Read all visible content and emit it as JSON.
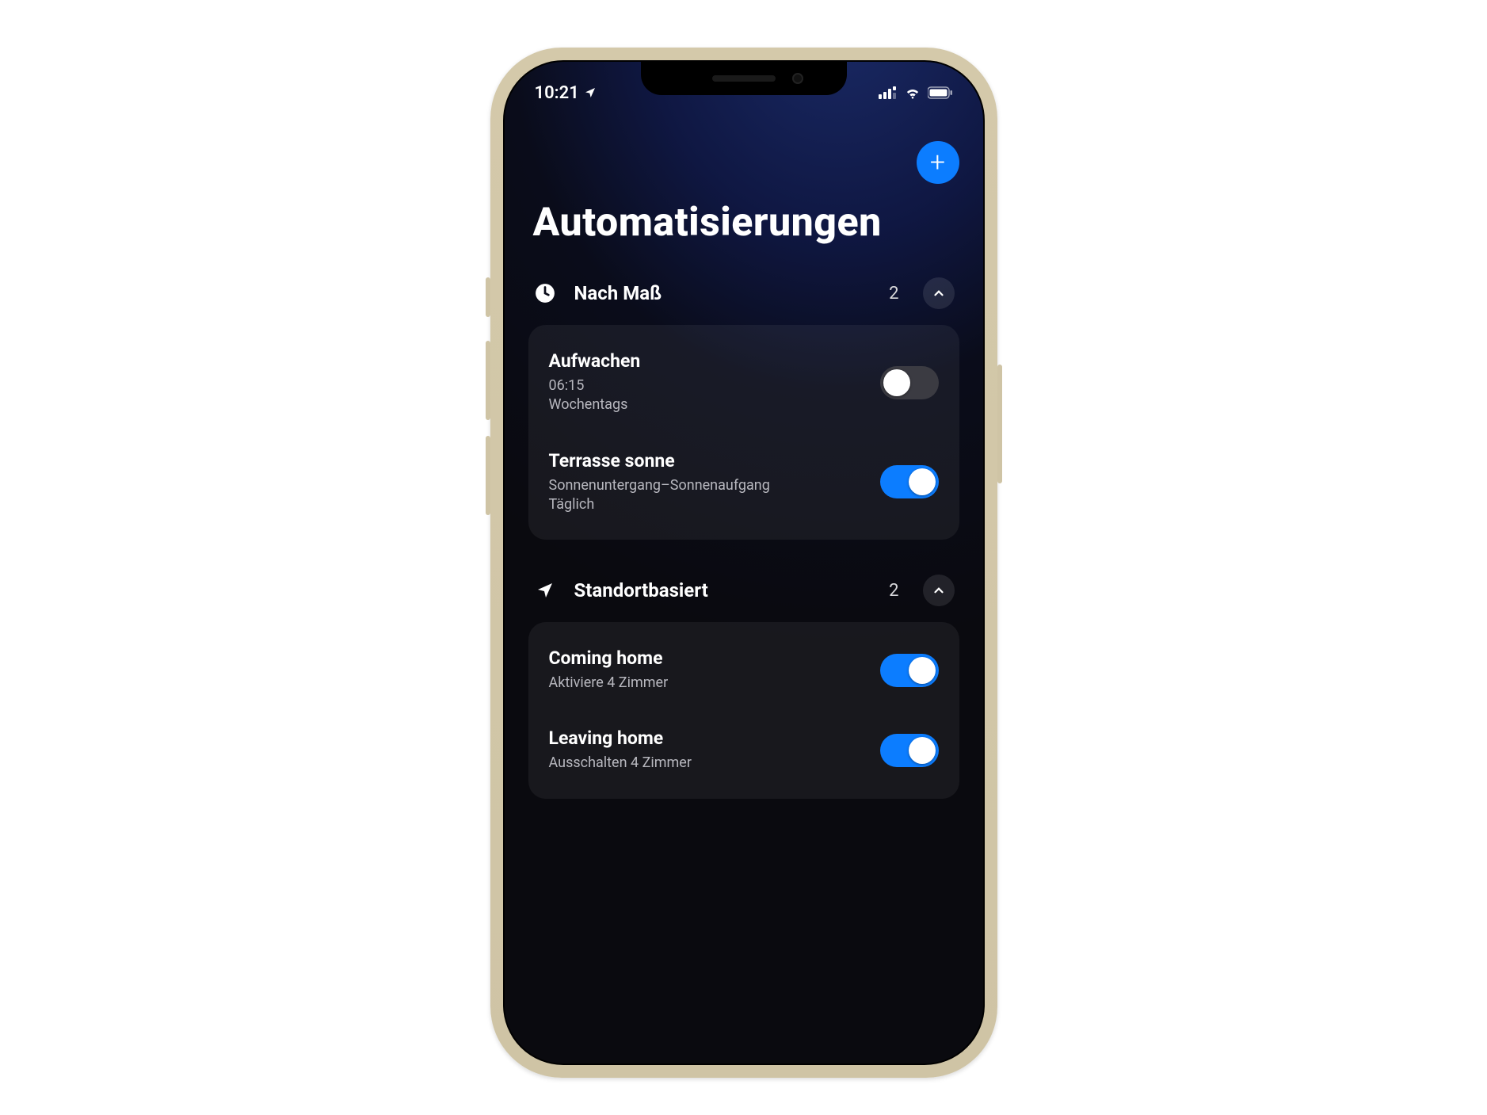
{
  "status": {
    "time": "10:21",
    "location_arrow": "navigation-icon"
  },
  "header": {
    "add": "+"
  },
  "page": {
    "title": "Automatisierungen"
  },
  "colors": {
    "accent": "#0c7dff"
  },
  "sections": [
    {
      "id": "scheduled",
      "icon": "clock-icon",
      "title": "Nach Maß",
      "count": "2",
      "items": [
        {
          "title": "Aufwachen",
          "line1": "06:15",
          "line2": "Wochentags",
          "enabled": false
        },
        {
          "title": "Terrasse sonne",
          "line1": "Sonnenuntergang–Sonnenaufgang",
          "line2": "Täglich",
          "enabled": true
        }
      ]
    },
    {
      "id": "location",
      "icon": "navigation-icon",
      "title": "Standortbasiert",
      "count": "2",
      "items": [
        {
          "title": "Coming home",
          "line1": "Aktiviere 4 Zimmer",
          "line2": "",
          "enabled": true
        },
        {
          "title": "Leaving home",
          "line1": "Ausschalten 4 Zimmer",
          "line2": "",
          "enabled": true
        }
      ]
    }
  ]
}
